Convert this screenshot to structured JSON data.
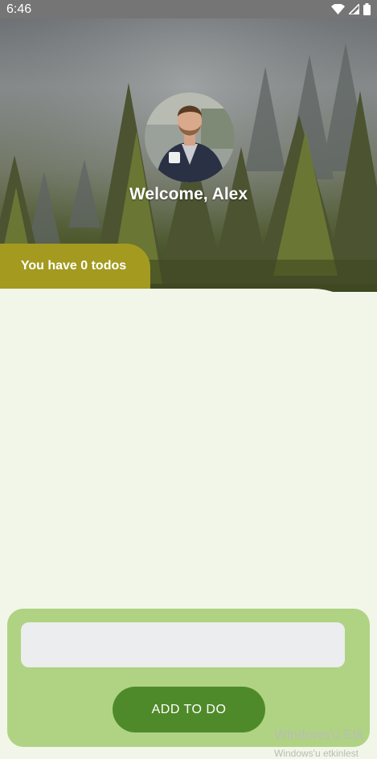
{
  "status_bar": {
    "time": "6:46",
    "icons": [
      "wifi-icon",
      "cell-signal-icon",
      "battery-icon"
    ]
  },
  "header": {
    "welcome_text": "Welcome, Alex"
  },
  "todo_summary": {
    "label": "You have 0 todos"
  },
  "add_form": {
    "input_value": "",
    "input_placeholder": "",
    "button_label": "ADD TO DO"
  },
  "watermark": {
    "line1": "Windows'u Etk",
    "line2": "Windows'u etkinlest"
  },
  "colors": {
    "status_bar_bg": "#757575",
    "tab_bg": "#a39a1f",
    "content_bg": "#f1f6e9",
    "card_bg": "#b0d383",
    "input_bg": "#ecedef",
    "button_bg": "#4f8a2a"
  }
}
